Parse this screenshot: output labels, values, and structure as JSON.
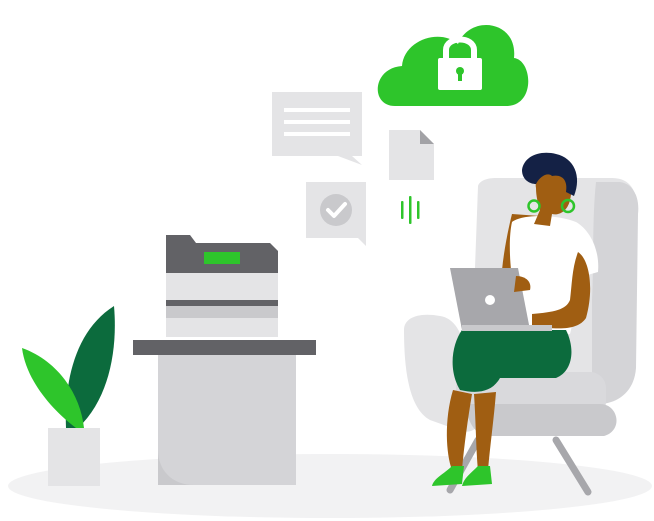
{
  "illustration": {
    "description_free": true,
    "icons": {
      "cloud": "cloud-lock-icon",
      "lock": "padlock-icon",
      "message": "chat-bubble-icon",
      "check": "checkmark-bubble-icon",
      "document": "document-icon",
      "signal": "transfer-lines-icon",
      "printer": "printer-icon",
      "plant": "potted-plant-icon",
      "laptop": "laptop-icon",
      "apple_logo": "laptop-logo-icon"
    },
    "colors": {
      "brand_green": "#2ec52b",
      "dark_green": "#0c6b3d",
      "skin": "#a05e12",
      "hair": "#142145",
      "light_gray": "#e4e4e6",
      "mid_gray": "#c9c9cc",
      "dark_gray": "#626266",
      "floor": "#f2f2f3",
      "white": "#ffffff"
    }
  }
}
